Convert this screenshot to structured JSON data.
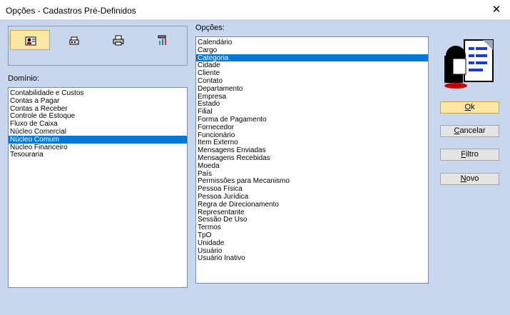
{
  "window": {
    "title": "Opções - Cadastros Pré-Definidos",
    "close_glyph": "✕"
  },
  "toolbar": {
    "buttons": [
      {
        "icon": "user-card-icon",
        "active": true
      },
      {
        "icon": "cash-register-icon",
        "active": false
      },
      {
        "icon": "printer-icon",
        "active": false
      },
      {
        "icon": "tools-chart-icon",
        "active": false
      }
    ]
  },
  "dominio": {
    "label": "Domínio:",
    "items": [
      "Contabilidade e Custos",
      "Contas a Pagar",
      "Contas a Receber",
      "Controle de Estoque",
      "Fluxo de Caixa",
      "Núcleo Comercial",
      "Núcleo Comum",
      "Núcleo Financeiro",
      "Tesouraria"
    ],
    "selected_index": 6
  },
  "opcoes": {
    "label": "Opções:",
    "items": [
      "Calendário",
      "Cargo",
      "Categoria",
      "Cidade",
      "Cliente",
      "Contato",
      "Departamento",
      "Empresa",
      "Estado",
      "Filial",
      "Forma de Pagamento",
      "Fornecedor",
      "Funcionário",
      "Item Externo",
      "Mensagens Enviadas",
      "Mensagens Recebidas",
      "Moeda",
      "País",
      "Permissões para Mecanismo",
      "Pessoa Física",
      "Pessoa Jurídica",
      "Regra de Direcionamento",
      "Representante",
      "Sessão De Uso",
      "Termos",
      "TpO",
      "Unidade",
      "Usuário",
      "Usuário Inativo"
    ],
    "selected_index": 2
  },
  "buttons": {
    "ok": {
      "first": "O",
      "rest": "k"
    },
    "cancelar": {
      "first": "C",
      "rest": "ancelar"
    },
    "filtro": {
      "first": "F",
      "rest": "iltro"
    },
    "novo": {
      "first": "N",
      "rest": "ovo"
    }
  },
  "colors": {
    "selection": "#0078d7",
    "background": "#c8d7ee",
    "default_button": "#fce8a4"
  }
}
